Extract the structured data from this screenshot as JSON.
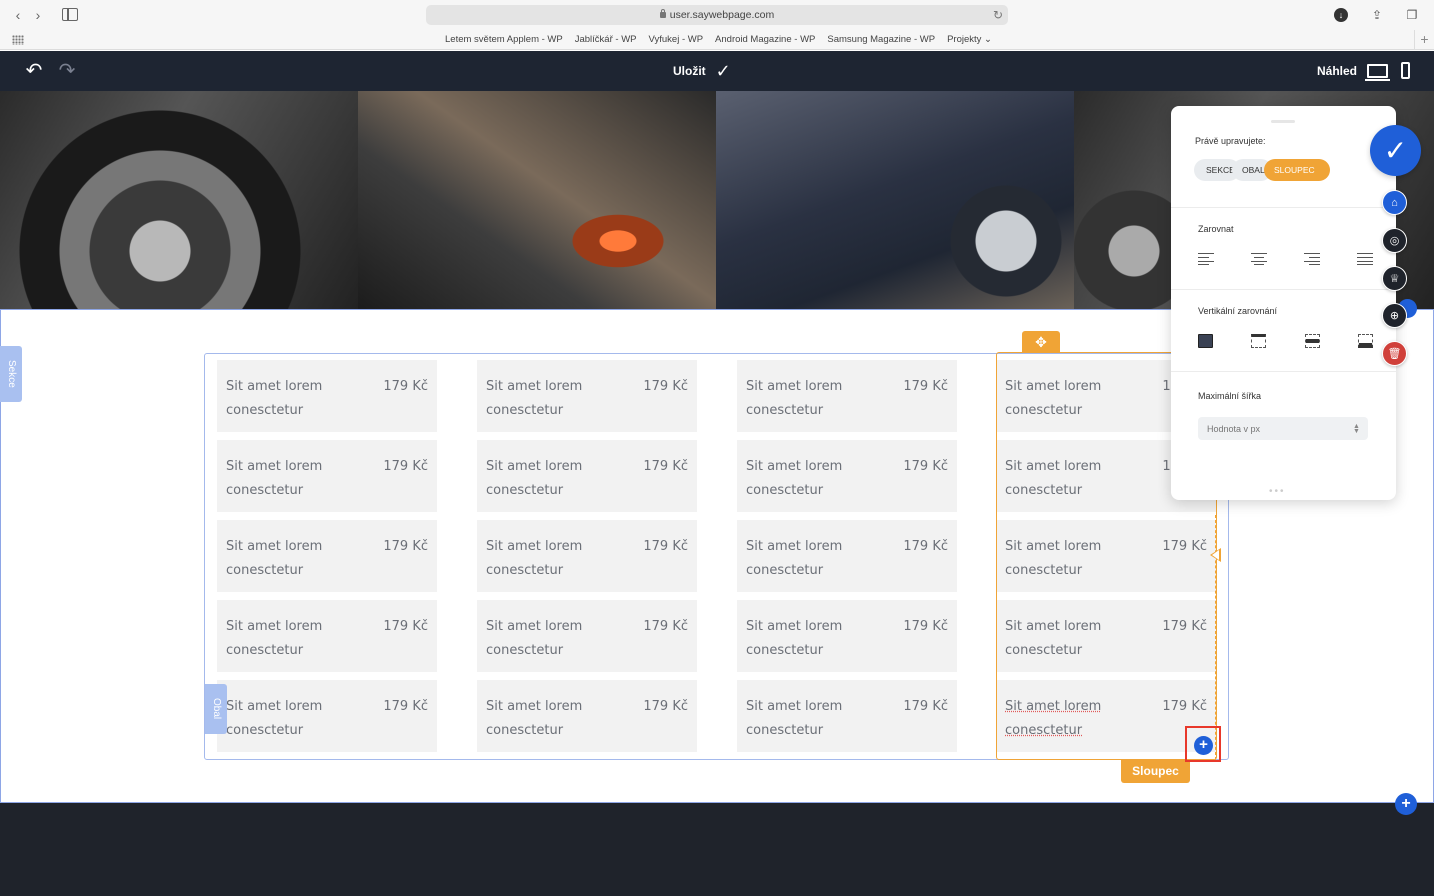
{
  "browser": {
    "back_icon": "chevron-left-icon",
    "forward_icon": "chevron-right-icon",
    "url": "user.saywebpage.com",
    "bookmarks": [
      "Letem světem Applem - WP",
      "Jablíčkář - WP",
      "Vyfukej - WP",
      "Android Magazine - WP",
      "Samsung Magazine - WP",
      "Projekty ⌄"
    ]
  },
  "toolbar": {
    "save_label": "Uložit",
    "preview_label": "Náhled",
    "background_color": "#1e2532"
  },
  "editor": {
    "section_tab": "Sekce",
    "wrapper_tab": "Obal",
    "column_label": "Sloupec",
    "accent_color": "#f0a436",
    "selection_color": "#1f5fd8"
  },
  "menu_columns": [
    {
      "items": [
        {
          "name": "Sit amet lorem conesctetur",
          "price": "179 Kč"
        },
        {
          "name": "Sit amet lorem conesctetur",
          "price": "179 Kč"
        },
        {
          "name": "Sit amet lorem conesctetur",
          "price": "179 Kč"
        },
        {
          "name": "Sit amet lorem conesctetur",
          "price": "179 Kč"
        },
        {
          "name": "Sit amet lorem conesctetur",
          "price": "179 Kč"
        }
      ]
    },
    {
      "items": [
        {
          "name": "Sit amet lorem conesctetur",
          "price": "179 Kč"
        },
        {
          "name": "Sit amet lorem conesctetur",
          "price": "179 Kč"
        },
        {
          "name": "Sit amet lorem conesctetur",
          "price": "179 Kč"
        },
        {
          "name": "Sit amet lorem conesctetur",
          "price": "179 Kč"
        },
        {
          "name": "Sit amet lorem conesctetur",
          "price": "179 Kč"
        }
      ]
    },
    {
      "items": [
        {
          "name": "Sit amet lorem conesctetur",
          "price": "179 Kč"
        },
        {
          "name": "Sit amet lorem conesctetur",
          "price": "179 Kč"
        },
        {
          "name": "Sit amet lorem conesctetur",
          "price": "179 Kč"
        },
        {
          "name": "Sit amet lorem conesctetur",
          "price": "179 Kč"
        },
        {
          "name": "Sit amet lorem conesctetur",
          "price": "179 Kč"
        }
      ]
    },
    {
      "items": [
        {
          "name": "Sit amet lorem conesctetur",
          "price": "179 Kč"
        },
        {
          "name": "Sit amet lorem conesctetur",
          "price": "179 Kč"
        },
        {
          "name": "Sit amet lorem conesctetur",
          "price": "179 Kč"
        },
        {
          "name": "Sit amet lorem conesctetur",
          "price": "179 Kč"
        },
        {
          "name": "Sit amet lorem conesctetur",
          "price": "179 Kč"
        }
      ]
    }
  ],
  "panel": {
    "editing_label": "Právě upravujete:",
    "crumbs": [
      "SEKCE",
      "OBAL",
      "SLOUPEC"
    ],
    "align_label": "Zarovnat",
    "align_options": [
      "align-left-icon",
      "align-center-icon",
      "align-right-icon",
      "align-justify-icon"
    ],
    "valign_label": "Vertikální zarovnání",
    "valign_options": [
      "valign-fill-icon",
      "valign-top-icon",
      "valign-middle-icon",
      "valign-bottom-icon"
    ],
    "max_width_label": "Maximální šířka",
    "max_width_placeholder": "Hodnota v px",
    "max_width_value": ""
  },
  "side_buttons": [
    "check-icon",
    "home-icon",
    "focus-icon",
    "style-icon",
    "add-element-icon",
    "delete-icon"
  ]
}
